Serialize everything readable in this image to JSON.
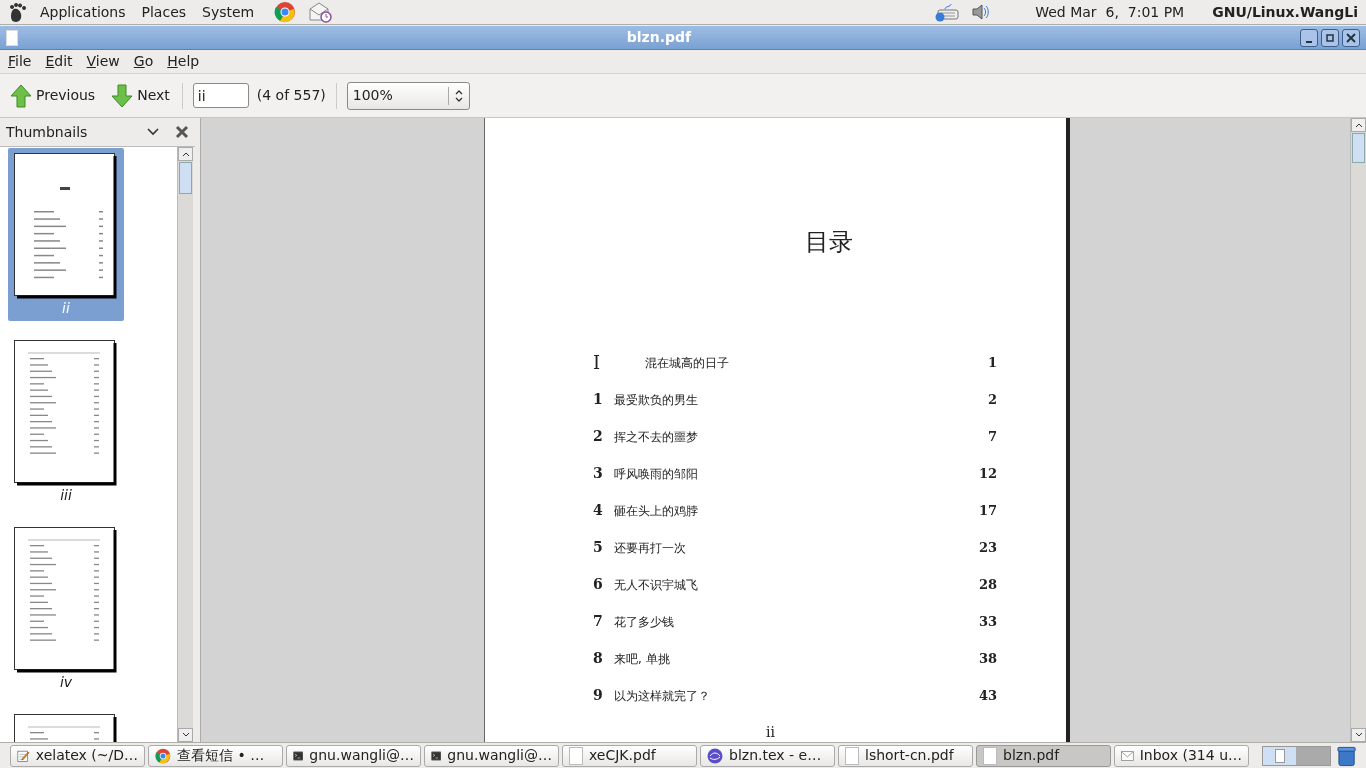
{
  "top_panel": {
    "menus": [
      "Applications",
      "Places",
      "System"
    ],
    "clock": "Wed Mar  6,  7:01 PM",
    "user": "GNU/Linux.WangLi"
  },
  "window": {
    "title": "blzn.pdf"
  },
  "menubar": [
    "File",
    "Edit",
    "View",
    "Go",
    "Help"
  ],
  "toolbar": {
    "previous": "Previous",
    "next": "Next",
    "page_field": "ii",
    "page_count": "(4 of 557)",
    "zoom": "100%"
  },
  "sidebar": {
    "title": "Thumbnails",
    "thumbnails": [
      {
        "label": "ii",
        "selected": true
      },
      {
        "label": "iii",
        "selected": false
      },
      {
        "label": "iv",
        "selected": false
      },
      {
        "selected": false
      }
    ]
  },
  "document": {
    "heading": "目录",
    "entries": [
      {
        "kind": "part",
        "number": "I",
        "title": "混在城高的日子",
        "page": "1"
      },
      {
        "kind": "chapter",
        "number": "1",
        "title": "最受欺负的男生",
        "page": "2"
      },
      {
        "kind": "chapter",
        "number": "2",
        "title": "挥之不去的噩梦",
        "page": "7"
      },
      {
        "kind": "chapter",
        "number": "3",
        "title": "呼风唤雨的邹阳",
        "page": "12"
      },
      {
        "kind": "chapter",
        "number": "4",
        "title": "砸在头上的鸡脖",
        "page": "17"
      },
      {
        "kind": "chapter",
        "number": "5",
        "title": "还要再打一次",
        "page": "23"
      },
      {
        "kind": "chapter",
        "number": "6",
        "title": "无人不识宇城飞",
        "page": "28"
      },
      {
        "kind": "chapter",
        "number": "7",
        "title": "花了多少钱",
        "page": "33"
      },
      {
        "kind": "chapter",
        "number": "8",
        "title": "来吧, 单挑",
        "page": "38"
      },
      {
        "kind": "chapter",
        "number": "9",
        "title": "以为这样就完了？",
        "page": "43"
      }
    ],
    "footer": "ii"
  },
  "taskbar": [
    {
      "kind": "editor",
      "label": "xelatex (~/D…",
      "selected": false
    },
    {
      "kind": "browser",
      "label": "查看短信 • …",
      "selected": false
    },
    {
      "kind": "terminal",
      "label": "gnu.wangli@…",
      "selected": false
    },
    {
      "kind": "terminal",
      "label": "gnu.wangli@…",
      "selected": false
    },
    {
      "kind": "document",
      "label": "xeCJK.pdf",
      "selected": false
    },
    {
      "kind": "web",
      "label": "blzn.tex - e…",
      "selected": false
    },
    {
      "kind": "document",
      "label": "lshort-cn.pdf",
      "selected": false
    },
    {
      "kind": "document",
      "label": "blzn.pdf",
      "selected": true
    },
    {
      "kind": "mail",
      "label": "Inbox (314 u…",
      "selected": false
    }
  ]
}
